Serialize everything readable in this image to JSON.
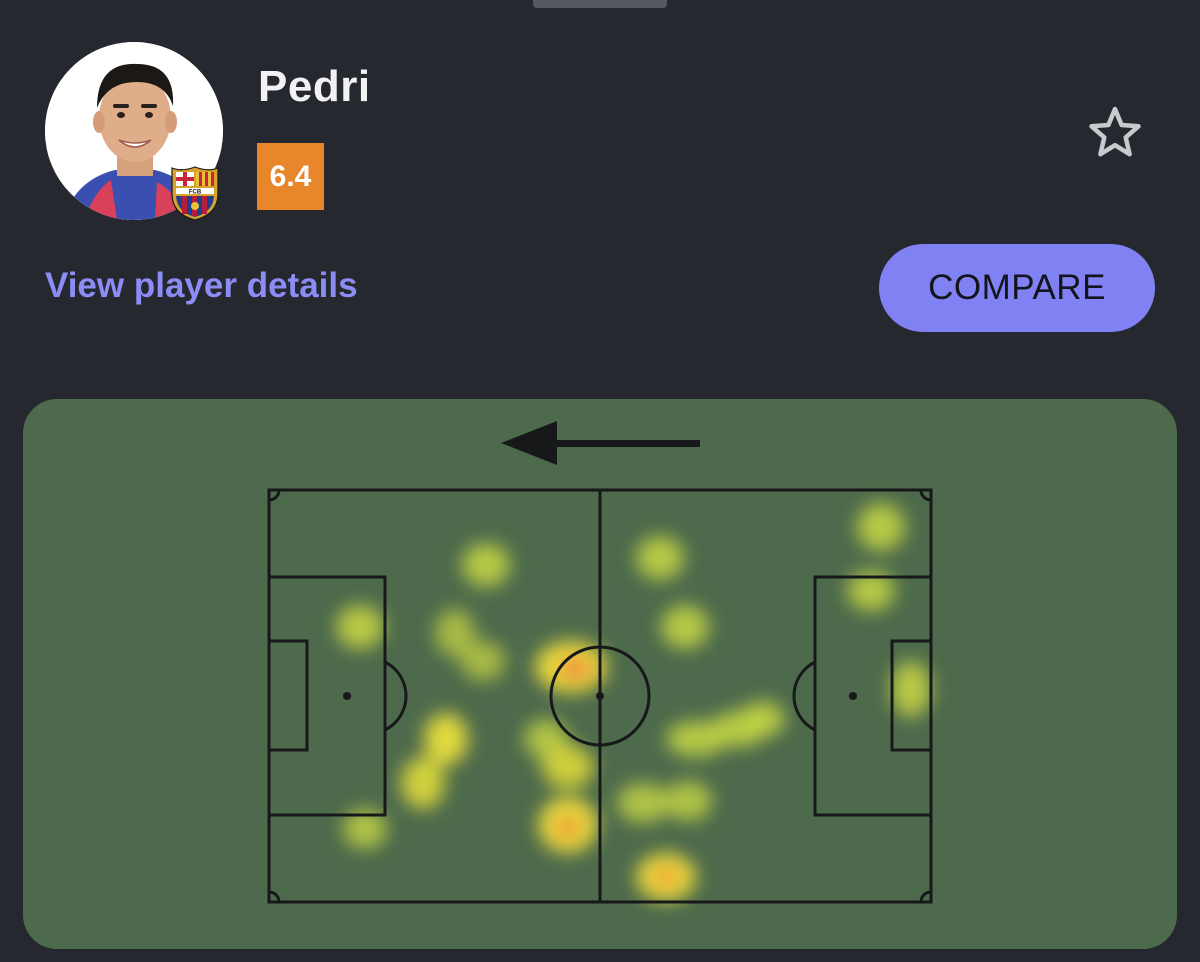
{
  "player": {
    "name": "Pedri",
    "rating": "6.4",
    "club_badge_icon": "fc-barcelona-crest",
    "club_badge_text": "FCB"
  },
  "actions": {
    "details_link": "View player details",
    "compare_label": "COMPARE",
    "favorite_icon": "star-outline-icon"
  },
  "heatmap": {
    "attack_direction": "left",
    "colors": {
      "pitch": "#4d6a4c",
      "low": "#b8d63a",
      "mid": "#f2e23c",
      "high": "#f08a3a"
    }
  },
  "colors": {
    "background": "#25282e",
    "accent": "#8082f3",
    "link": "#8b8cf6",
    "rating": "#e8862c"
  }
}
